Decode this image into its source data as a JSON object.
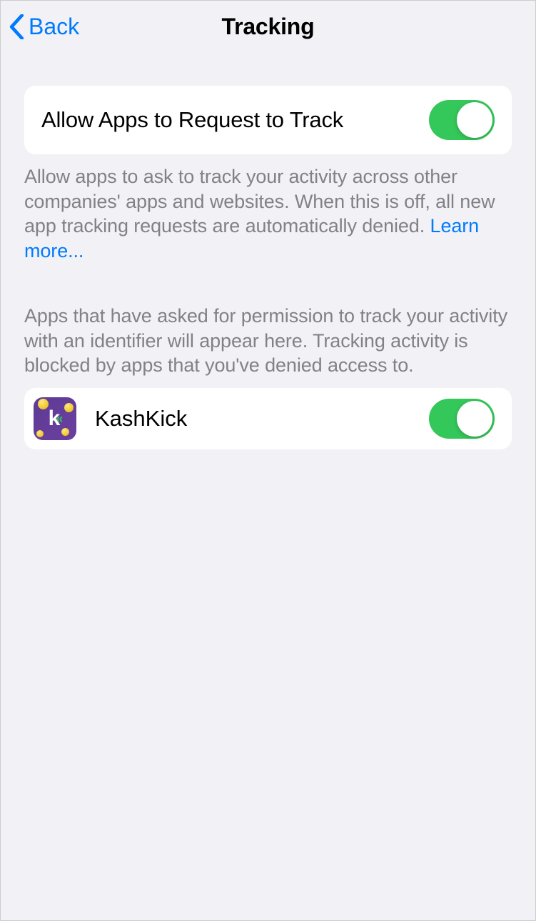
{
  "header": {
    "back_label": "Back",
    "title": "Tracking"
  },
  "main_toggle": {
    "label": "Allow Apps to Request to Track",
    "enabled": true
  },
  "description1": {
    "text": "Allow apps to ask to track your activity across other companies' apps and websites. When this is off, all new app tracking requests are automatically denied. ",
    "link_text": "Learn more..."
  },
  "description2": "Apps that have asked for permission to track your activity with an identifier will appear here. Tracking activity is blocked by apps that you've denied access to.",
  "apps": [
    {
      "name": "KashKick",
      "enabled": true
    }
  ]
}
